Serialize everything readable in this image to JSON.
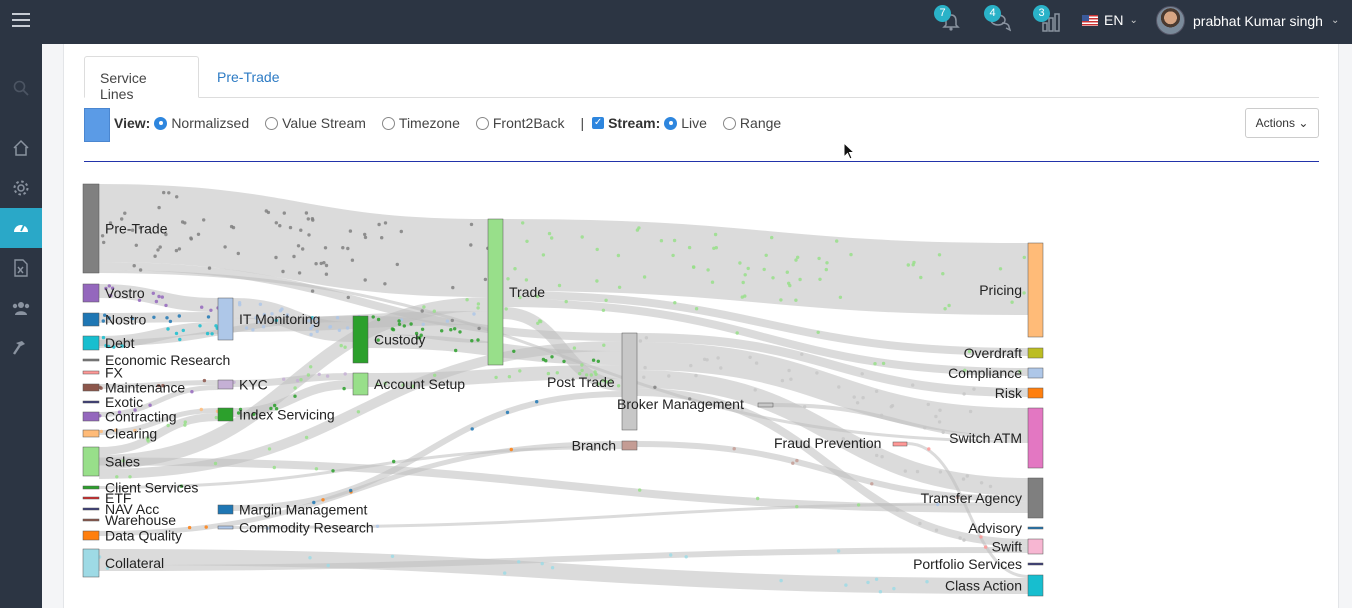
{
  "header": {
    "notifications_count": "7",
    "messages_count": "4",
    "stats_count": "3",
    "language": "EN",
    "user_name": "prabhat Kumar singh"
  },
  "sidebar": {
    "items": [
      "search-icon",
      "home-icon",
      "gear-icon",
      "dashboard-icon",
      "excel-icon",
      "users-icon",
      "hammer-icon"
    ],
    "active": "dashboard-icon"
  },
  "tabs": [
    "Service Lines",
    "Pre-Trade"
  ],
  "toolbar": {
    "view_label": "View:",
    "view_options": [
      "Normalizsed",
      "Value Stream",
      "Timezone",
      "Front2Back"
    ],
    "view_selected": "Normalizsed",
    "separator": "|",
    "stream_label": "Stream:",
    "stream_checked": true,
    "stream_options": [
      "Live",
      "Range"
    ],
    "stream_selected": "Live",
    "actions_label": "Actions"
  },
  "colors": {
    "topbar": "#2c3543",
    "accent": "#2aa8c8",
    "link": "#2d7bc4",
    "swatch": "#5b9be6",
    "rule": "#2233aa"
  },
  "sankey": {
    "nodes": [
      {
        "label": "Pre-Trade",
        "color": "#808080"
      },
      {
        "label": "Vostro",
        "color": "#9467bd"
      },
      {
        "label": "Nostro",
        "color": "#1f77b4"
      },
      {
        "label": "Debt",
        "color": "#17becf"
      },
      {
        "label": "Economic Research",
        "color": "#7f7f7f"
      },
      {
        "label": "FX",
        "color": "#ff9896"
      },
      {
        "label": "Maintenance",
        "color": "#8c564b"
      },
      {
        "label": "Exotic",
        "color": "#393b79"
      },
      {
        "label": "Contracting",
        "color": "#9467bd"
      },
      {
        "label": "Clearing",
        "color": "#ffbb78"
      },
      {
        "label": "Sales",
        "color": "#98df8a"
      },
      {
        "label": "Client Services",
        "color": "#2ca02c"
      },
      {
        "label": "ETF",
        "color": "#d62728"
      },
      {
        "label": "NAV Acc",
        "color": "#393b79"
      },
      {
        "label": "Warehouse",
        "color": "#8c564b"
      },
      {
        "label": "Data Quality",
        "color": "#ff7f0e"
      },
      {
        "label": "Collateral",
        "color": "#9edae5"
      },
      {
        "label": "IT Monitoring",
        "color": "#aec7e8"
      },
      {
        "label": "KYC",
        "color": "#c5b0d5"
      },
      {
        "label": "Index Servicing",
        "color": "#2ca02c"
      },
      {
        "label": "Margin Management",
        "color": "#1f77b4"
      },
      {
        "label": "Commodity Research",
        "color": "#aec7e8"
      },
      {
        "label": "Custody",
        "color": "#2ca02c"
      },
      {
        "label": "Account Setup",
        "color": "#98df8a"
      },
      {
        "label": "Trade",
        "color": "#98df8a"
      },
      {
        "label": "Post Trade",
        "color": "#c7c7c7"
      },
      {
        "label": "Broker Management",
        "color": "#c7c7c7"
      },
      {
        "label": "Branch",
        "color": "#c49c94"
      },
      {
        "label": "Fraud Prevention",
        "color": "#ff9896"
      },
      {
        "label": "Pricing",
        "color": "#ffbb78"
      },
      {
        "label": "Overdraft",
        "color": "#bcbd22"
      },
      {
        "label": "Compliance",
        "color": "#aec7e8"
      },
      {
        "label": "Risk",
        "color": "#ff7f0e"
      },
      {
        "label": "Switch ATM",
        "color": "#e377c2"
      },
      {
        "label": "Transfer Agency",
        "color": "#7f7f7f"
      },
      {
        "label": "Advisory",
        "color": "#1f77b4"
      },
      {
        "label": "Swift",
        "color": "#f7b6d2"
      },
      {
        "label": "Portfolio Services",
        "color": "#393b79"
      },
      {
        "label": "Class Action",
        "color": "#17becf"
      }
    ]
  }
}
